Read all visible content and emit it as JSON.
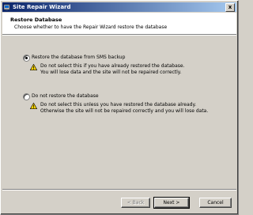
{
  "window": {
    "title": "Site Repair Wizard",
    "close_glyph": "x"
  },
  "header": {
    "title": "Restore Database",
    "subtitle": "Choose whether to have the Repair Wizard restore the database"
  },
  "options": [
    {
      "label": "Restore the database from SMS backup",
      "selected": true,
      "warning_lines": [
        "Do not select this if you have already restored the database.",
        "You will lose data and the site will not be repaired correctly."
      ]
    },
    {
      "label": "Do not restore the database",
      "selected": false,
      "warning_lines": [
        "Do not select this unless you have restored the database already.",
        "Otherwise the site will not be repaired correctly and you will lose data."
      ]
    }
  ],
  "buttons": {
    "back_label": "< Back",
    "next_label": "Next >",
    "cancel_label": "Cancel"
  },
  "icons": {
    "title": "wizard-icon",
    "warning": "warning-icon"
  },
  "colors": {
    "titlebar_start": "#0a246a",
    "titlebar_end": "#a6caf0",
    "warning_yellow": "#ffd700"
  }
}
